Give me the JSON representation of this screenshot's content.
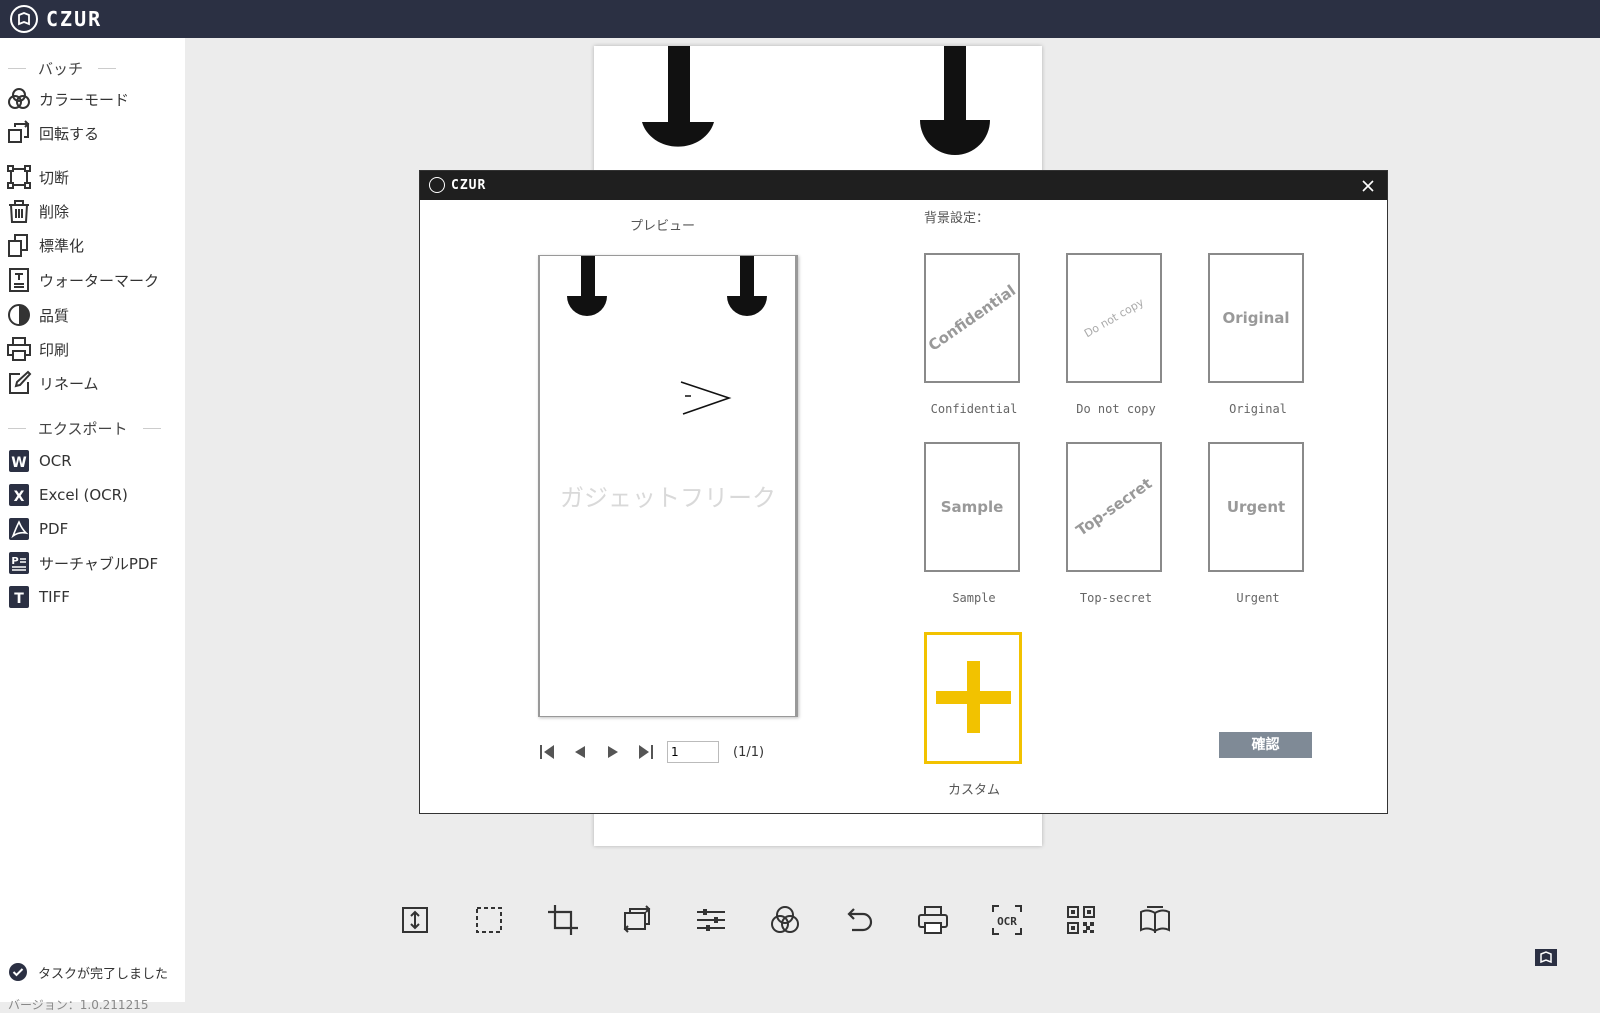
{
  "app": {
    "logo_text": "CZUR"
  },
  "sidebar": {
    "batch_header": "バッチ",
    "batch_items": [
      {
        "label": "カラーモード",
        "icon": "color-mode-icon"
      },
      {
        "label": "回転する",
        "icon": "rotate-icon"
      },
      {
        "label": "切断",
        "icon": "crop-icon"
      },
      {
        "label": "削除",
        "icon": "delete-icon"
      },
      {
        "label": "標準化",
        "icon": "normalize-icon"
      },
      {
        "label": "ウォーターマーク",
        "icon": "watermark-icon"
      },
      {
        "label": "品質",
        "icon": "quality-icon"
      },
      {
        "label": "印刷",
        "icon": "print-icon"
      },
      {
        "label": "リネーム",
        "icon": "rename-icon"
      }
    ],
    "export_header": "エクスポート",
    "export_items": [
      {
        "label": "OCR",
        "icon": "word-icon",
        "badge": "W"
      },
      {
        "label": "Excel (OCR)",
        "icon": "excel-icon",
        "badge": "X"
      },
      {
        "label": "PDF",
        "icon": "pdf-icon",
        "badge": "A"
      },
      {
        "label": "サーチャブルPDF",
        "icon": "searchable-pdf-icon",
        "badge": "P"
      },
      {
        "label": "TIFF",
        "icon": "tiff-icon",
        "badge": "T"
      }
    ],
    "status_text": "タスクが完了しました",
    "version_text": "バージョン：1.0.211215"
  },
  "toolbar": {
    "icons": [
      "fit-height-icon",
      "select-area-icon",
      "crop-icon",
      "rotate-icon",
      "adjust-icon",
      "color-icon",
      "undo-icon",
      "print-icon",
      "ocr-icon",
      "qr-code-icon",
      "book-icon"
    ],
    "ocr_label": "OCR"
  },
  "dialog": {
    "title_logo": "CZUR",
    "preview_label": "プレビュー",
    "preview_watermark": "ガジェットフリーク",
    "page_input": "1",
    "page_count": "(1/1)",
    "background_label": "背景設定：",
    "watermarks": [
      {
        "card_text": "Confidential",
        "caption": "Confidential"
      },
      {
        "card_text": "Do not copy",
        "caption": "Do not copy"
      },
      {
        "card_text": "Original",
        "caption": "Original"
      },
      {
        "card_text": "Sample",
        "caption": "Sample"
      },
      {
        "card_text": "Top-secret",
        "caption": "Top-secret"
      },
      {
        "card_text": "Urgent",
        "caption": "Urgent"
      }
    ],
    "custom_caption": "カスタム",
    "confirm_label": "確認"
  },
  "colors": {
    "topbar": "#2b3043",
    "dialog_title": "#1f1f1f",
    "custom_accent": "#f2c200",
    "confirm_button": "#7f8a96"
  }
}
